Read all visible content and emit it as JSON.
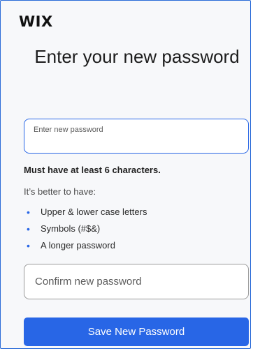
{
  "brand": {
    "logo_text": "WIX"
  },
  "header": {
    "title": "Enter your new password"
  },
  "form": {
    "new_password": {
      "placeholder": "Enter new password",
      "value": ""
    },
    "requirement": "Must have at least 6 characters.",
    "better_intro": "It’s better to have:",
    "tips": [
      {
        "label": "Upper & lower case letters"
      },
      {
        "label": "Symbols (#$&)"
      },
      {
        "label": "A longer password"
      }
    ],
    "confirm_password": {
      "placeholder": "Confirm new password",
      "value": ""
    },
    "submit_label": "Save New Password"
  },
  "colors": {
    "accent": "#2866e6",
    "frame_border": "#2a6bd8",
    "background": "#f7f8fa"
  }
}
